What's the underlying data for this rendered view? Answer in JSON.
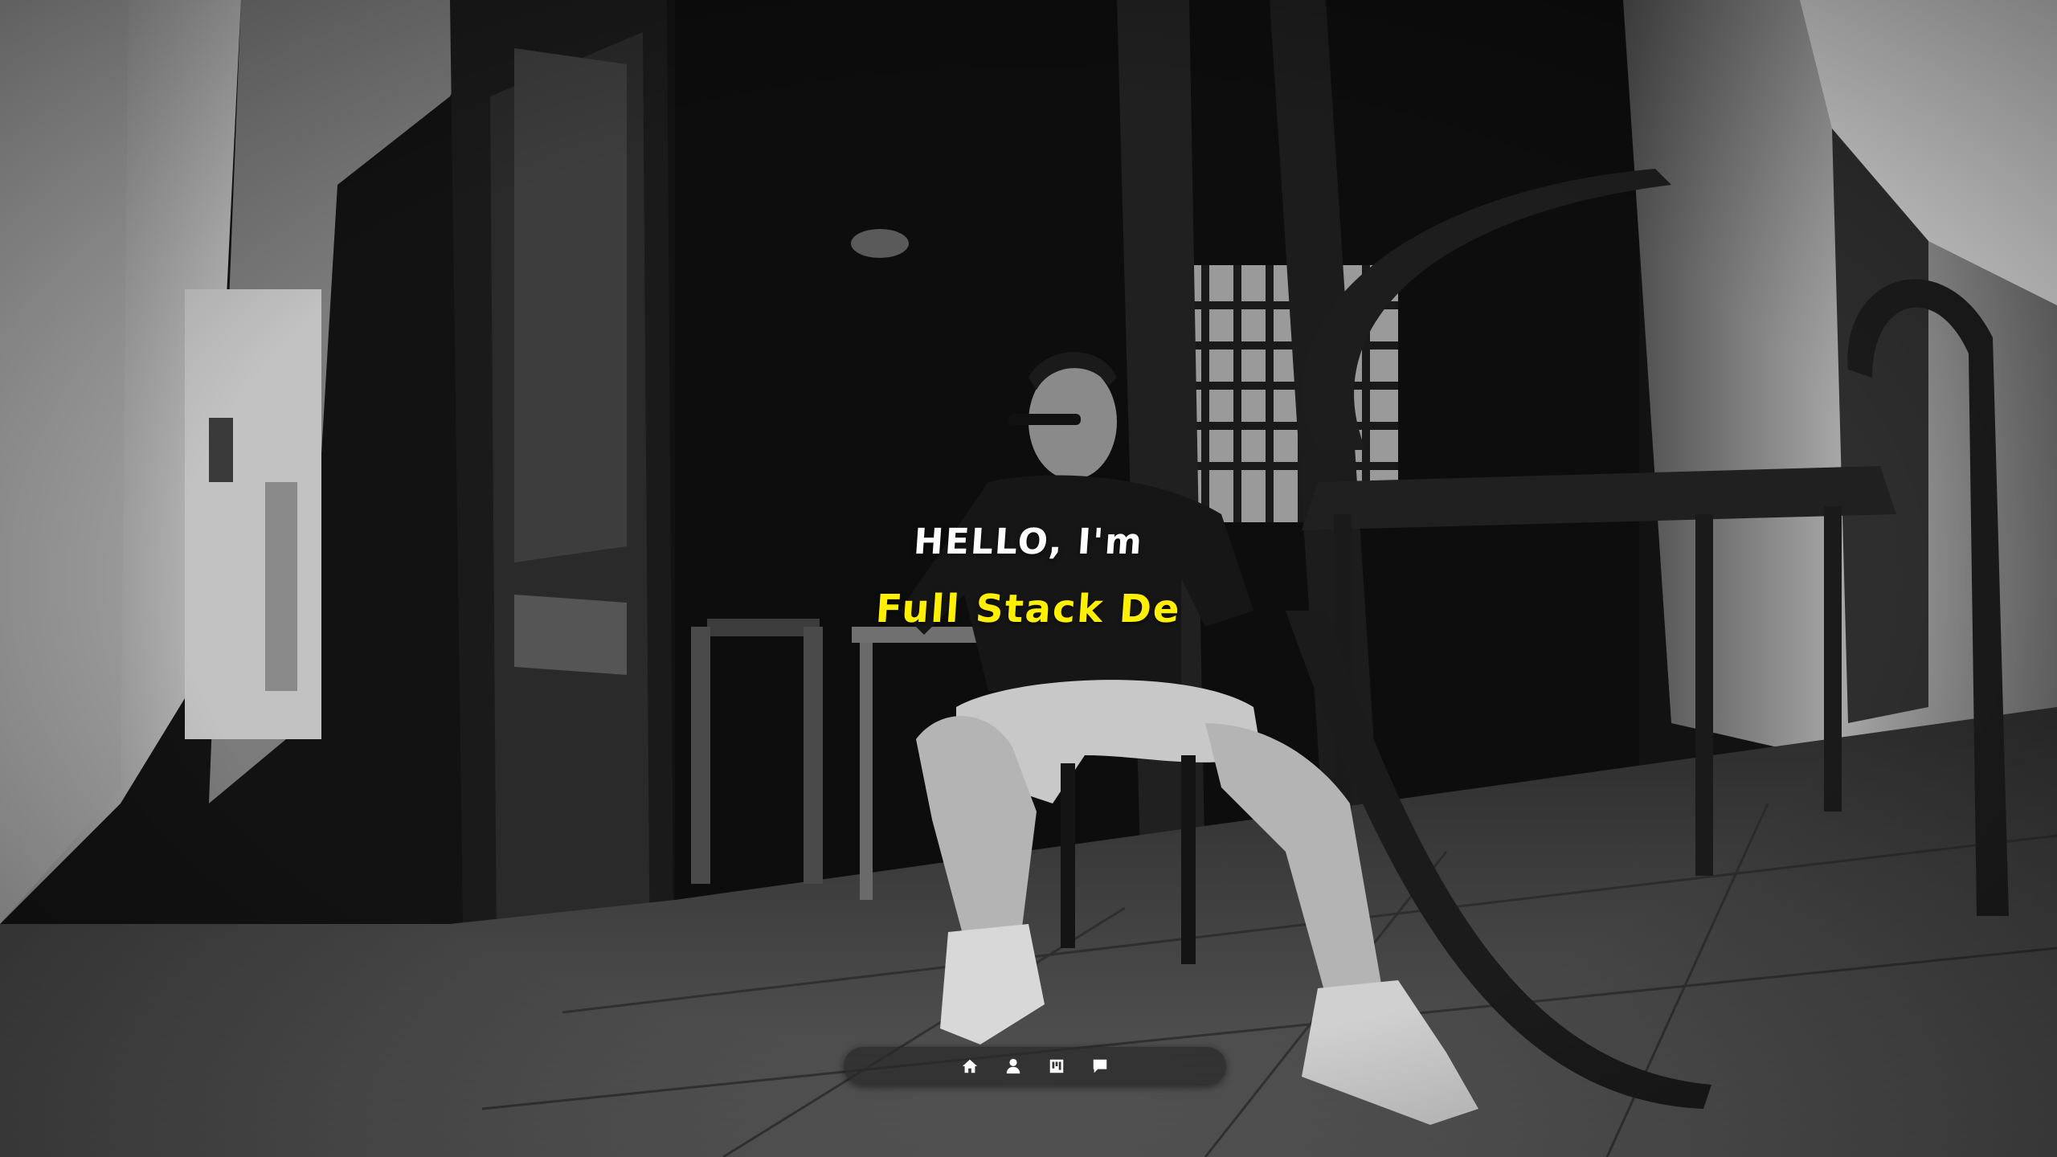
{
  "hero": {
    "greeting": "HELLO, I'm",
    "role_typed": "Full Stack De"
  },
  "dock": {
    "items": [
      {
        "icon": "home-icon"
      },
      {
        "icon": "user-icon"
      },
      {
        "icon": "projects-icon"
      },
      {
        "icon": "message-icon"
      }
    ]
  },
  "colors": {
    "greeting": "#ffffff",
    "role": "#ffef00",
    "dock_background": "#282828"
  }
}
